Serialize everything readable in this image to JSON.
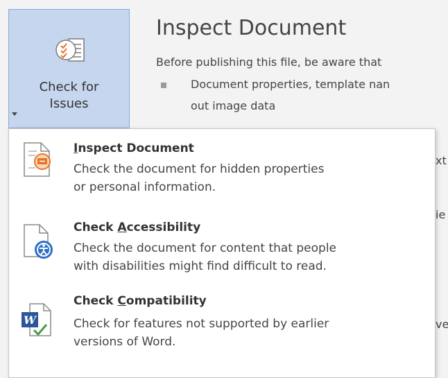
{
  "check_button": {
    "line1": "Check for",
    "line2": "Issues"
  },
  "background": {
    "title": "Inspect Document",
    "description": "Before publishing this file, be aware that",
    "bullet_line1": "Document properties, template nan",
    "bullet_line2": "out image data",
    "peek": [
      "xt",
      "ie",
      "ve"
    ]
  },
  "menu": {
    "items": [
      {
        "title_prefix": "",
        "title_accel": "I",
        "title_rest": "nspect Document",
        "desc_line1": "Check the document for hidden properties",
        "desc_line2": "or personal information.",
        "icon": "inspect-document-icon"
      },
      {
        "title_prefix": "Check ",
        "title_accel": "A",
        "title_rest": "ccessibility",
        "desc_line1": "Check the document for content that people",
        "desc_line2": "with disabilities might find difficult to read.",
        "icon": "accessibility-icon"
      },
      {
        "title_prefix": "Check ",
        "title_accel": "C",
        "title_rest": "ompatibility",
        "desc_line1": "Check for features not supported by earlier",
        "desc_line2": "versions of Word.",
        "icon": "compatibility-icon"
      }
    ]
  },
  "colors": {
    "button_bg": "#c5d6ee",
    "button_border": "#8aaad6",
    "accent_orange": "#e8732b",
    "accent_blue": "#2a6fc7",
    "word_blue": "#2b579a",
    "check_green": "#4a9a4a"
  }
}
